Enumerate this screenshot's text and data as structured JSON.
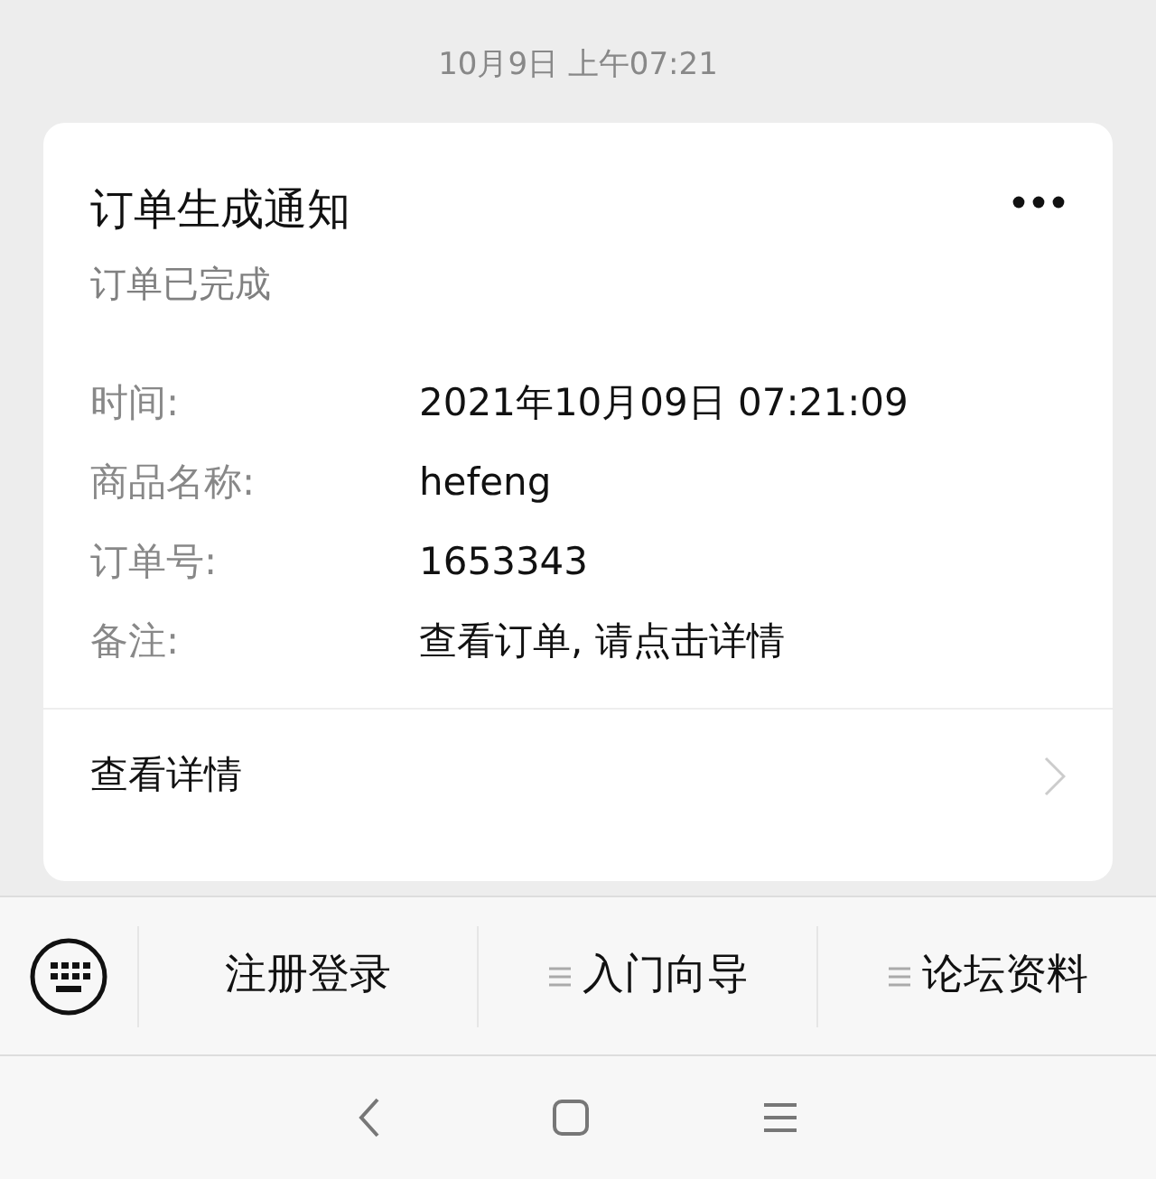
{
  "timestamp": "10月9日 上午07:21",
  "card": {
    "title": "订单生成通知",
    "subtitle": "订单已完成",
    "fields": [
      {
        "label": "时间:",
        "value": "2021年10月09日 07:21:09"
      },
      {
        "label": "商品名称:",
        "value": "hefeng"
      },
      {
        "label": "订单号:",
        "value": "1653343"
      },
      {
        "label": "备注:",
        "value": "查看订单, 请点击详情"
      }
    ],
    "link": "查看详情"
  },
  "menu": [
    {
      "label": "注册登录",
      "submenu": false
    },
    {
      "label": "入门向导",
      "submenu": true
    },
    {
      "label": "论坛资料",
      "submenu": true
    }
  ]
}
